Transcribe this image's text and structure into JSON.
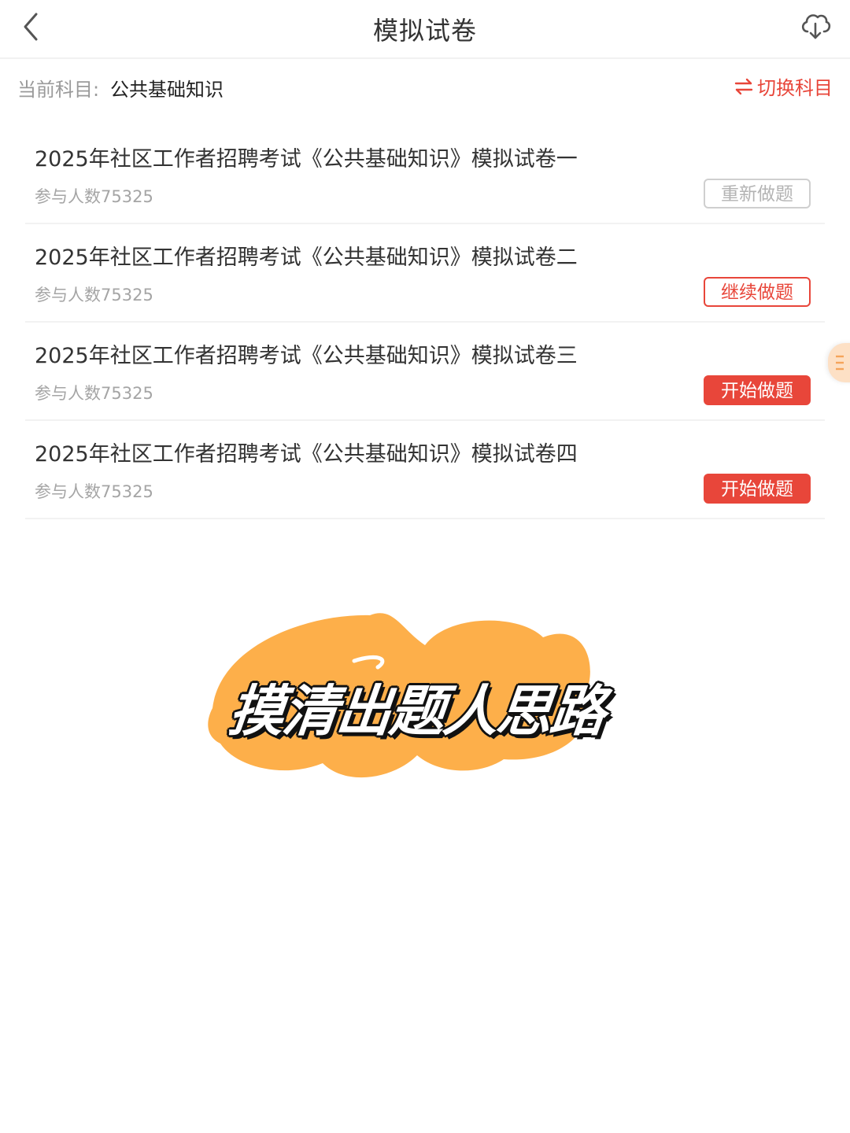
{
  "header": {
    "title": "模拟试卷",
    "back_icon": "chevron-left-icon",
    "download_icon": "cloud-download-icon"
  },
  "subject_bar": {
    "label": "当前科目:",
    "value": "公共基础知识",
    "switch_label": "切换科目",
    "switch_icon": "swap-arrows-icon"
  },
  "exams": [
    {
      "title": "2025年社区工作者招聘考试《公共基础知识》模拟试卷一",
      "participants": "参与人数75325",
      "button": "重新做题",
      "button_style": "redo"
    },
    {
      "title": "2025年社区工作者招聘考试《公共基础知识》模拟试卷二",
      "participants": "参与人数75325",
      "button": "继续做题",
      "button_style": "continue"
    },
    {
      "title": "2025年社区工作者招聘考试《公共基础知识》模拟试卷三",
      "participants": "参与人数75325",
      "button": "开始做题",
      "button_style": "start"
    },
    {
      "title": "2025年社区工作者招聘考试《公共基础知识》模拟试卷四",
      "participants": "参与人数75325",
      "button": "开始做题",
      "button_style": "start"
    }
  ],
  "overlay": {
    "text": "摸清出题人思路"
  },
  "colors": {
    "accent": "#e8463a",
    "brush": "#fdaf4a",
    "muted": "#a5a5a5"
  }
}
